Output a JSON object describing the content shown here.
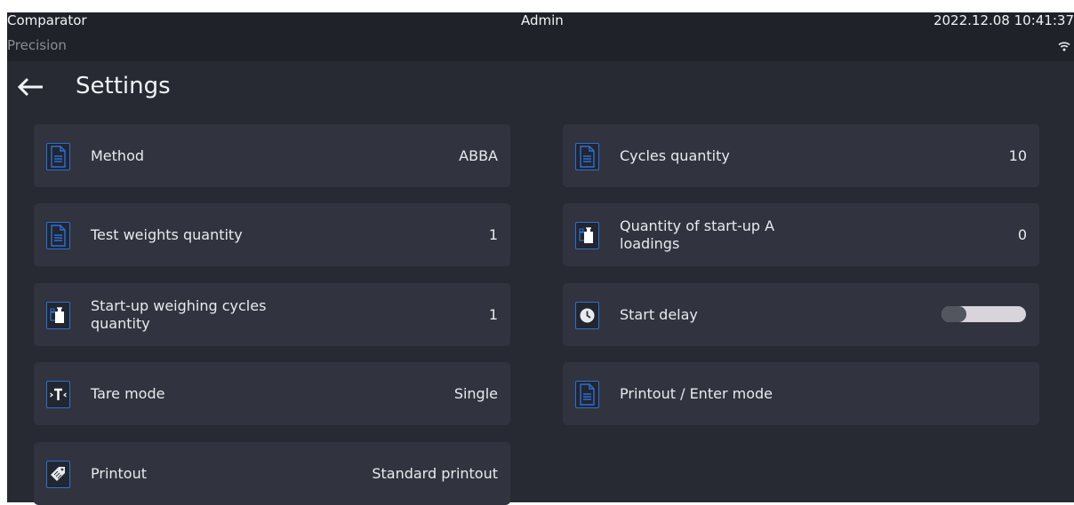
{
  "header": {
    "app_name": "Comparator",
    "mode": "Precision",
    "user": "Admin",
    "datetime": "2022.12.08 10:41:37",
    "status_icon": "wifi-icon"
  },
  "page": {
    "title": "Settings",
    "back_icon": "back-arrow-icon"
  },
  "settings": [
    {
      "label": "Method",
      "value": "ABBA",
      "icon": "document-icon"
    },
    {
      "label": "Cycles quantity",
      "value": "10",
      "icon": "document-icon"
    },
    {
      "label": "Test weights quantity",
      "value": "1",
      "icon": "document-icon"
    },
    {
      "label": "Quantity of start-up A loadings",
      "value": "0",
      "icon": "weights-icon"
    },
    {
      "label": "Start-up weighing cycles quantity",
      "value": "1",
      "icon": "weights-icon"
    },
    {
      "label": "Start delay",
      "value": null,
      "toggle_on": false,
      "icon": "clock-icon"
    },
    {
      "label": "Tare mode",
      "value": "Single",
      "icon": "tare-icon"
    },
    {
      "label": "Printout / Enter mode",
      "value": null,
      "icon": "document-icon"
    },
    {
      "label": "Printout",
      "value": "Standard printout",
      "icon": "tag-icon"
    }
  ],
  "colors": {
    "background": "#272a33",
    "tile": "#31343e",
    "icon_accent": "#2e6fd6"
  }
}
